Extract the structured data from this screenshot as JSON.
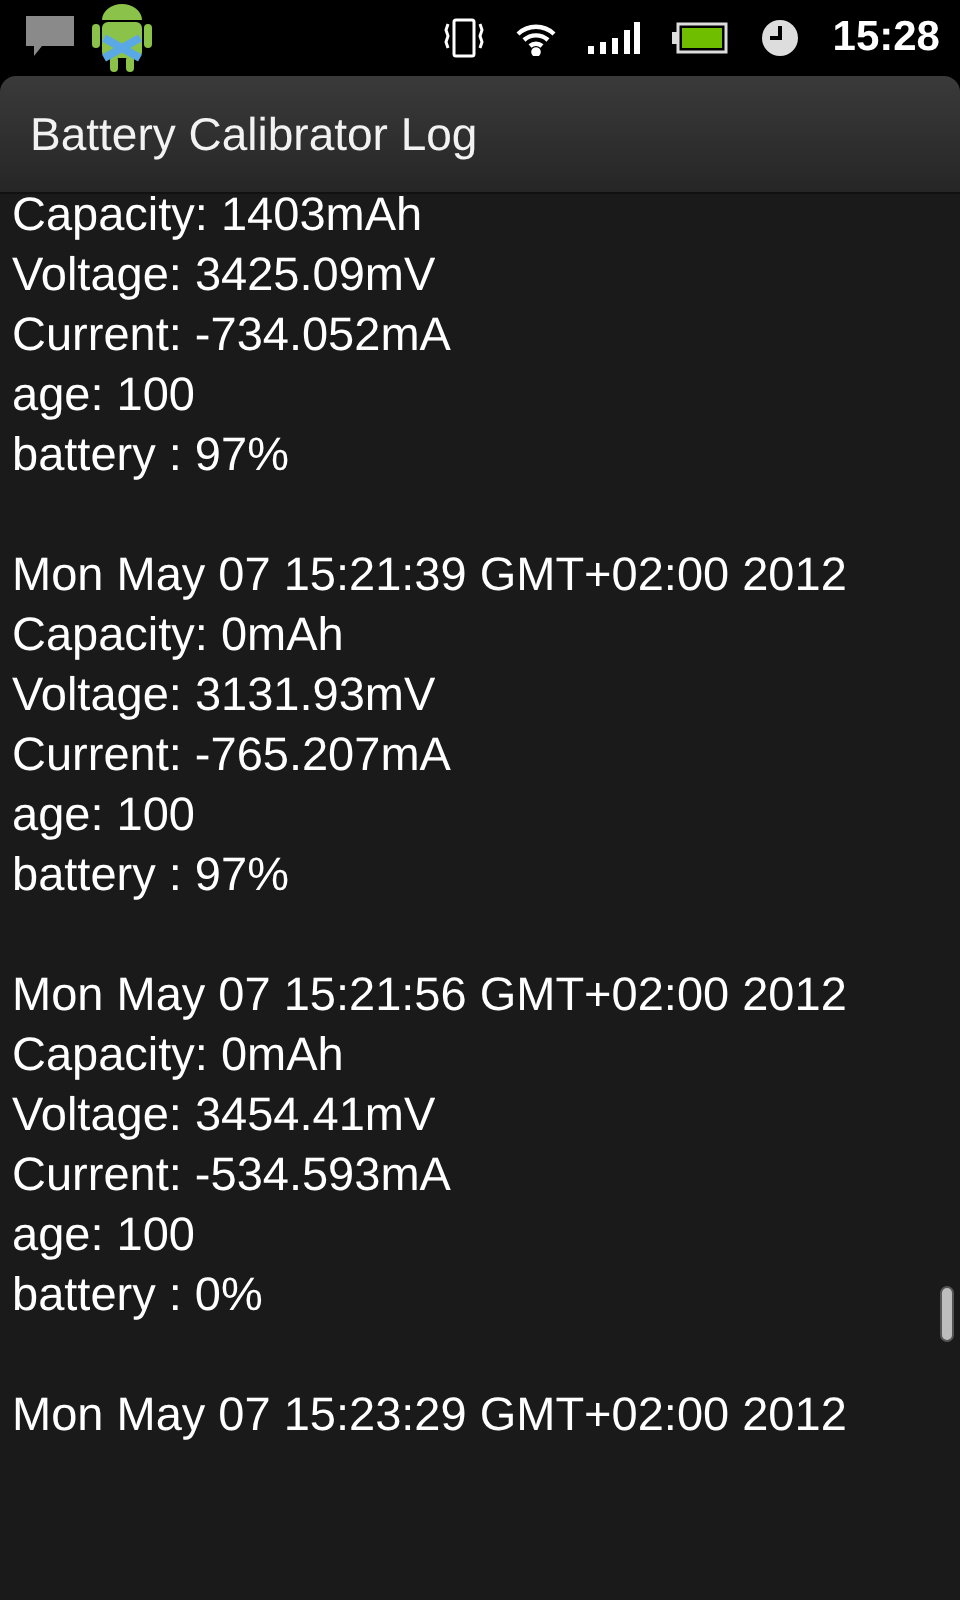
{
  "status_bar": {
    "time": "15:28"
  },
  "title_bar": {
    "title": "Battery Calibrator Log"
  },
  "log_entries": [
    {
      "lines": [
        "Capacity: 1403mAh",
        "Voltage: 3425.09mV",
        "Current: -734.052mA",
        "age: 100",
        "battery : 97%"
      ]
    },
    {
      "lines": [
        "Mon May 07 15:21:39 GMT+02:00 2012",
        "Capacity: 0mAh",
        "Voltage: 3131.93mV",
        "Current: -765.207mA",
        "age: 100",
        "battery : 97%"
      ]
    },
    {
      "lines": [
        "Mon May 07 15:21:56 GMT+02:00 2012",
        "Capacity: 0mAh",
        "Voltage: 3454.41mV",
        "Current: -534.593mA",
        "age: 100",
        "battery : 0%"
      ]
    },
    {
      "lines": [
        "Mon May 07 15:23:29 GMT+02:00 2012"
      ]
    }
  ]
}
